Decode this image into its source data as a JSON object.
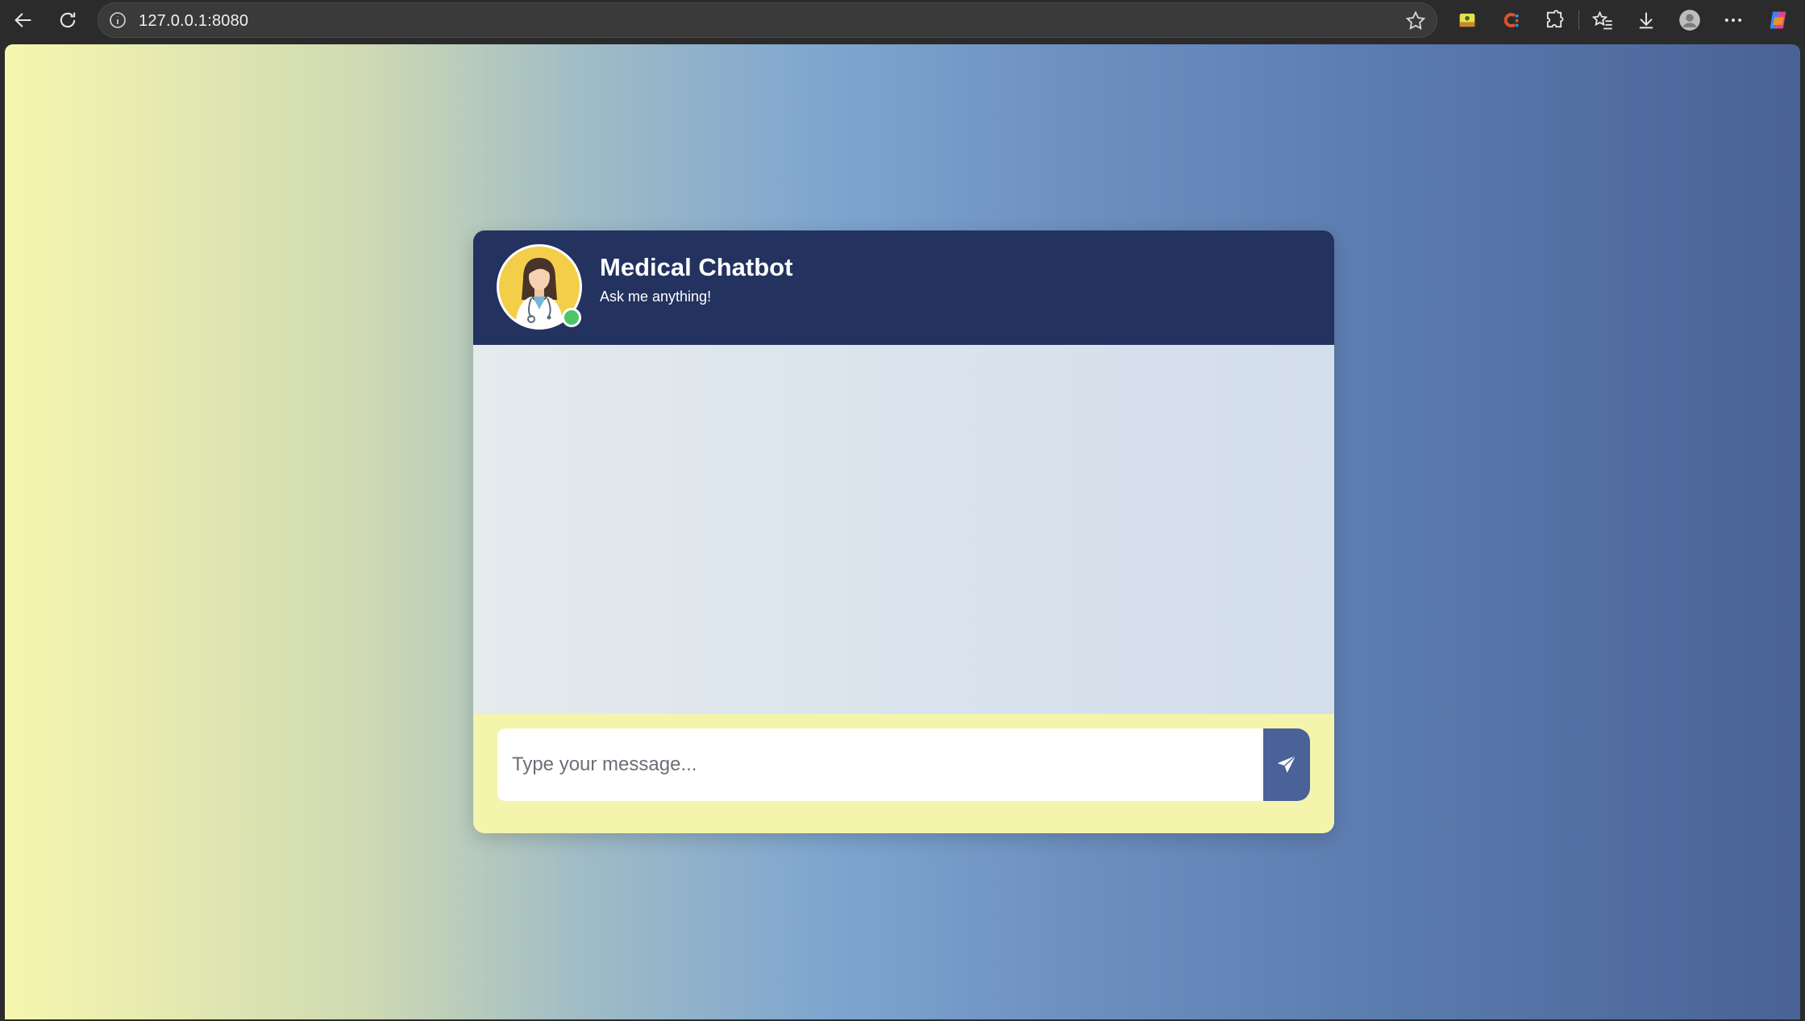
{
  "browser": {
    "url": "127.0.0.1:8080",
    "icons": [
      "back-arrow-icon",
      "reload-icon",
      "site-info-icon",
      "favorite-star-icon",
      "extension-icon",
      "extension-c-icon",
      "puzzle-icon",
      "favorites-icon",
      "download-icon",
      "profile-icon",
      "more-icon",
      "copilot-icon"
    ]
  },
  "chat": {
    "title": "Medical Chatbot",
    "subtitle": "Ask me anything!",
    "avatar": "doctor-avatar",
    "status": "online",
    "input_placeholder": "Type your message...",
    "send_icon": "send-arrow-icon",
    "messages": []
  },
  "colors": {
    "header_bg": "#23325f",
    "footer_bg": "#f4f4ad",
    "send_bg": "#4a6298",
    "online": "#4cc56a",
    "avatar_bg": "#f3cf49"
  }
}
